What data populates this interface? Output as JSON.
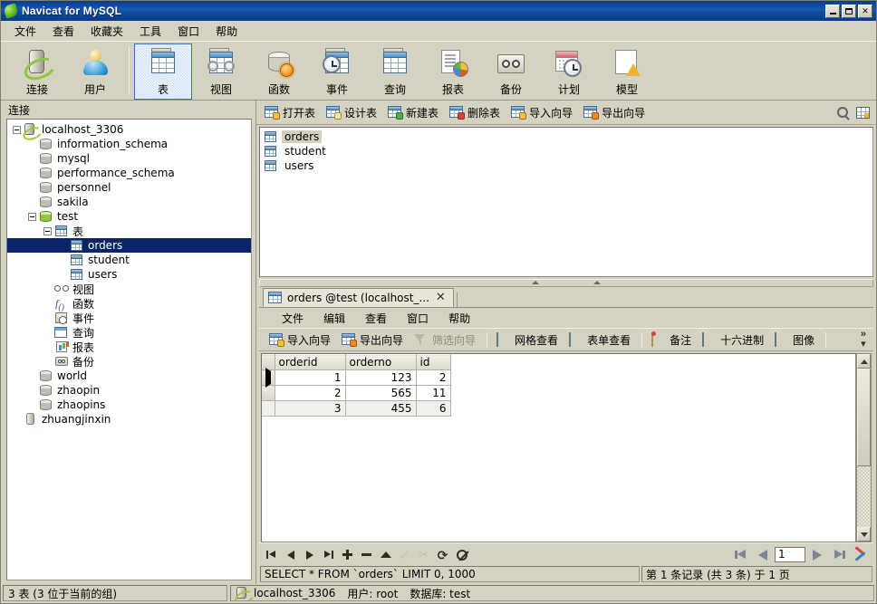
{
  "window": {
    "title": "Navicat for MySQL",
    "icon": "navicat-leaf-icon",
    "controls": {
      "minimize": "minimize-button",
      "maximize": "maximize-button",
      "close": "✕"
    }
  },
  "menubar": {
    "items": [
      {
        "label": "文件",
        "name": "menu-file"
      },
      {
        "label": "查看",
        "name": "menu-view"
      },
      {
        "label": "收藏夹",
        "name": "menu-favorites"
      },
      {
        "label": "工具",
        "name": "menu-tools"
      },
      {
        "label": "窗口",
        "name": "menu-window"
      },
      {
        "label": "帮助",
        "name": "menu-help"
      }
    ]
  },
  "toolbar": {
    "items": [
      {
        "label": "连接",
        "icon": "connection-icon",
        "selected": false
      },
      {
        "label": "用户",
        "icon": "user-icon",
        "selected": false
      },
      {
        "label": "表",
        "icon": "table-icon",
        "selected": true
      },
      {
        "label": "视图",
        "icon": "view-icon",
        "selected": false
      },
      {
        "label": "函数",
        "icon": "function-icon",
        "selected": false
      },
      {
        "label": "事件",
        "icon": "event-icon",
        "selected": false
      },
      {
        "label": "查询",
        "icon": "query-icon",
        "selected": false
      },
      {
        "label": "报表",
        "icon": "report-icon",
        "selected": false
      },
      {
        "label": "备份",
        "icon": "backup-icon",
        "selected": false
      },
      {
        "label": "计划",
        "icon": "schedule-icon",
        "selected": false
      },
      {
        "label": "模型",
        "icon": "model-icon",
        "selected": false
      }
    ]
  },
  "sidebar": {
    "title": "连接",
    "tree": [
      {
        "label": "localhost_3306",
        "icon": "server-icon",
        "indent": 0,
        "twist": "minus",
        "selected": false
      },
      {
        "label": "information_schema",
        "icon": "database-icon",
        "indent": 1,
        "twist": "none",
        "selected": false
      },
      {
        "label": "mysql",
        "icon": "database-icon",
        "indent": 1,
        "twist": "none",
        "selected": false
      },
      {
        "label": "performance_schema",
        "icon": "database-icon",
        "indent": 1,
        "twist": "none",
        "selected": false
      },
      {
        "label": "personnel",
        "icon": "database-icon",
        "indent": 1,
        "twist": "none",
        "selected": false
      },
      {
        "label": "sakila",
        "icon": "database-icon",
        "indent": 1,
        "twist": "none",
        "selected": false
      },
      {
        "label": "test",
        "icon": "database-open-icon",
        "indent": 1,
        "twist": "minus",
        "selected": false
      },
      {
        "label": "表",
        "icon": "tables-folder-icon",
        "indent": 2,
        "twist": "minus",
        "selected": false
      },
      {
        "label": "orders",
        "icon": "table-icon",
        "indent": 3,
        "twist": "none",
        "selected": true
      },
      {
        "label": "student",
        "icon": "table-icon",
        "indent": 3,
        "twist": "none",
        "selected": false
      },
      {
        "label": "users",
        "icon": "table-icon",
        "indent": 3,
        "twist": "none",
        "selected": false
      },
      {
        "label": "视图",
        "icon": "views-icon",
        "indent": 2,
        "twist": "none",
        "selected": false
      },
      {
        "label": "函数",
        "icon": "functions-icon",
        "indent": 2,
        "twist": "none",
        "selected": false
      },
      {
        "label": "事件",
        "icon": "events-icon",
        "indent": 2,
        "twist": "none",
        "selected": false
      },
      {
        "label": "查询",
        "icon": "queries-icon",
        "indent": 2,
        "twist": "none",
        "selected": false
      },
      {
        "label": "报表",
        "icon": "reports-icon",
        "indent": 2,
        "twist": "none",
        "selected": false
      },
      {
        "label": "备份",
        "icon": "backups-icon",
        "indent": 2,
        "twist": "none",
        "selected": false
      },
      {
        "label": "world",
        "icon": "database-icon",
        "indent": 1,
        "twist": "none",
        "selected": false
      },
      {
        "label": "zhaopin",
        "icon": "database-icon",
        "indent": 1,
        "twist": "none",
        "selected": false
      },
      {
        "label": "zhaopins",
        "icon": "database-icon",
        "indent": 1,
        "twist": "none",
        "selected": false
      },
      {
        "label": "zhuangjinxin",
        "icon": "server-plain-icon",
        "indent": 0,
        "twist": "none",
        "selected": false
      }
    ]
  },
  "object_toolbar": {
    "buttons": [
      {
        "label": "打开表",
        "icon": "open-table-icon",
        "badge": "yellow"
      },
      {
        "label": "设计表",
        "icon": "design-table-icon",
        "badge": "pencil"
      },
      {
        "label": "新建表",
        "icon": "new-table-icon",
        "badge": "green"
      },
      {
        "label": "删除表",
        "icon": "delete-table-icon",
        "badge": "red"
      },
      {
        "label": "导入向导",
        "icon": "import-wizard-icon",
        "badge": "yellow"
      },
      {
        "label": "导出向导",
        "icon": "export-wizard-icon",
        "badge": "orange"
      }
    ],
    "search_icon": "search-icon",
    "gridview_icon": "grid-view-icon"
  },
  "table_list": {
    "items": [
      {
        "label": "orders",
        "selected": true
      },
      {
        "label": "student",
        "selected": false
      },
      {
        "label": "users",
        "selected": false
      }
    ]
  },
  "data_window": {
    "tab": {
      "label": "orders @test (localhost_...",
      "close": "✕",
      "icon": "table-icon"
    },
    "menu": [
      {
        "label": "文件",
        "name": "submenu-file"
      },
      {
        "label": "编辑",
        "name": "submenu-edit"
      },
      {
        "label": "查看",
        "name": "submenu-view"
      },
      {
        "label": "窗口",
        "name": "submenu-window"
      },
      {
        "label": "帮助",
        "name": "submenu-help"
      }
    ],
    "toolbar": {
      "import_wizard": "导入向导",
      "export_wizard": "导出向导",
      "filter_wizard": "筛选向导",
      "grid_view": "网格查看",
      "form_view": "表单查看",
      "note": "备注",
      "hex": "十六进制",
      "image": "图像",
      "overflow": "»",
      "dropdown": "▾"
    },
    "grid": {
      "columns": [
        "orderid",
        "orderno",
        "id"
      ],
      "rows": [
        {
          "cells": [
            "1",
            "123",
            "2"
          ],
          "current": true
        },
        {
          "cells": [
            "2",
            "565",
            "11"
          ],
          "current": false
        },
        {
          "cells": [
            "3",
            "455",
            "6"
          ],
          "current": false
        }
      ]
    },
    "navbar": {
      "first": "first-record",
      "prev": "previous-record",
      "next": "next-record",
      "last": "last-record",
      "add": "+",
      "remove": "−",
      "up": "move-up",
      "apply": "✓",
      "cut": "✂",
      "refresh": "⟳",
      "stop": "stop"
    },
    "pagination": {
      "first": "first-page",
      "prev": "previous-page",
      "page_value": "1",
      "next": "next-page",
      "last": "last-page",
      "tools_icon": "tools-icon"
    },
    "sql": "SELECT * FROM `orders` LIMIT 0, 1000",
    "record_info": "第 1 条记录 (共 3 条) 于 1 页"
  },
  "statusbar": {
    "left": "3 表 (3 位于当前的组)",
    "connection": "localhost_3306",
    "user": "用户: root",
    "database": "数据库: test"
  },
  "colors": {
    "titlebar_blue": "#0f4ea1",
    "selection_blue": "#0a246a",
    "window_bg": "#d6d2c2",
    "accent_green": "#8dc63f"
  }
}
